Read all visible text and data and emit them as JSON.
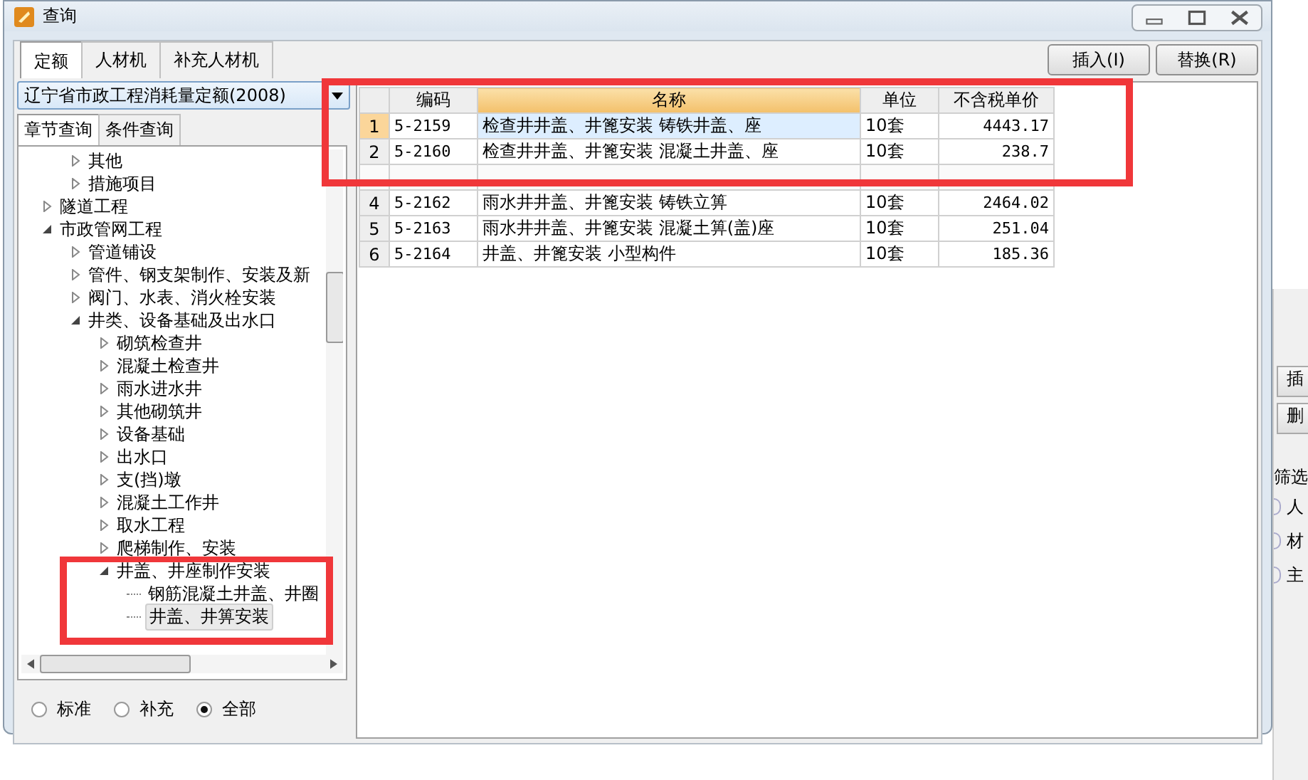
{
  "window": {
    "title": "查询"
  },
  "tabs": [
    {
      "label": "定额",
      "selected": true
    },
    {
      "label": "人材机",
      "selected": false
    },
    {
      "label": "补充人材机",
      "selected": false
    }
  ],
  "buttons": [
    "插入(I)",
    "替换(R)"
  ],
  "library_select": {
    "value": "辽宁省市政工程消耗量定额(2008)"
  },
  "sub_tabs": [
    {
      "label": "章节查询",
      "selected": true
    },
    {
      "label": "条件查询",
      "selected": false
    }
  ],
  "tree": [
    {
      "children": [
        {
          "label": "其他",
          "expanded": false
        },
        {
          "label": "措施项目",
          "expanded": false
        }
      ]
    },
    {
      "label": "隧道工程",
      "expanded": false
    },
    {
      "label": "市政管网工程",
      "expanded": true,
      "children": [
        {
          "label": "管道铺设",
          "expanded": false
        },
        {
          "label": "管件、钢支架制作、安装及新",
          "expanded": false
        },
        {
          "label": "阀门、水表、消火栓安装",
          "expanded": false
        },
        {
          "label": "井类、设备基础及出水口",
          "expanded": true,
          "children": [
            {
              "label": "砌筑检查井",
              "expanded": false
            },
            {
              "label": "混凝土检查井",
              "expanded": false
            },
            {
              "label": "雨水进水井",
              "expanded": false
            },
            {
              "label": "其他砌筑井",
              "expanded": false
            },
            {
              "label": "设备基础",
              "expanded": false
            },
            {
              "label": "出水口",
              "expanded": false
            },
            {
              "label": "支(挡)墩",
              "expanded": false
            },
            {
              "label": "混凝土工作井",
              "expanded": false
            },
            {
              "label": "取水工程",
              "expanded": false
            },
            {
              "label": "爬梯制作、安装",
              "expanded": false
            },
            {
              "label": "井盖、井座制作安装",
              "expanded": true,
              "children": [
                {
                  "label": "钢筋混凝土井盖、井圈",
                  "selected": false
                },
                {
                  "label": "井盖、井箅安装",
                  "selected": true
                }
              ]
            }
          ]
        }
      ]
    }
  ],
  "filters": [
    {
      "label": "标准",
      "selected": false
    },
    {
      "label": "补充",
      "selected": false
    },
    {
      "label": "全部",
      "selected": true
    }
  ],
  "table": {
    "columns": [
      {
        "label": "编码",
        "sorted": false
      },
      {
        "label": "名称",
        "sorted": true
      },
      {
        "label": "单位",
        "sorted": false
      },
      {
        "label": "不含税单价",
        "sorted": false
      }
    ],
    "rows": [
      {
        "num": "1",
        "code": "5-2159",
        "name": "检查井井盖、井篦安装 铸铁井盖、座",
        "unit": "10套",
        "price": "4443.17",
        "selected": true,
        "covered": false
      },
      {
        "num": "2",
        "code": "5-2160",
        "name": "检查井井盖、井篦安装 混凝土井盖、座",
        "unit": "10套",
        "price": "238.7",
        "selected": false,
        "covered": false
      },
      {
        "selected": false,
        "covered": true
      },
      {
        "num": "4",
        "code": "5-2162",
        "name": "雨水井井盖、井篦安装 铸铁立箅",
        "unit": "10套",
        "price": "2464.02",
        "selected": false,
        "covered": false
      },
      {
        "num": "5",
        "code": "5-2163",
        "name": "雨水井井盖、井篦安装 混凝土箅(盖)座",
        "unit": "10套",
        "price": "251.04",
        "selected": false,
        "covered": false
      },
      {
        "num": "6",
        "code": "5-2164",
        "name": "井盖、井篦安装 小型构件",
        "unit": "10套",
        "price": "185.36",
        "selected": false,
        "covered": false
      }
    ]
  },
  "highlight_frames": [
    {
      "kind": "frame"
    },
    {
      "kind": "frame"
    }
  ],
  "background_window": {
    "buttons": [
      "插",
      "删"
    ],
    "label": "筛选",
    "options": [
      "人",
      "材",
      "主"
    ]
  }
}
